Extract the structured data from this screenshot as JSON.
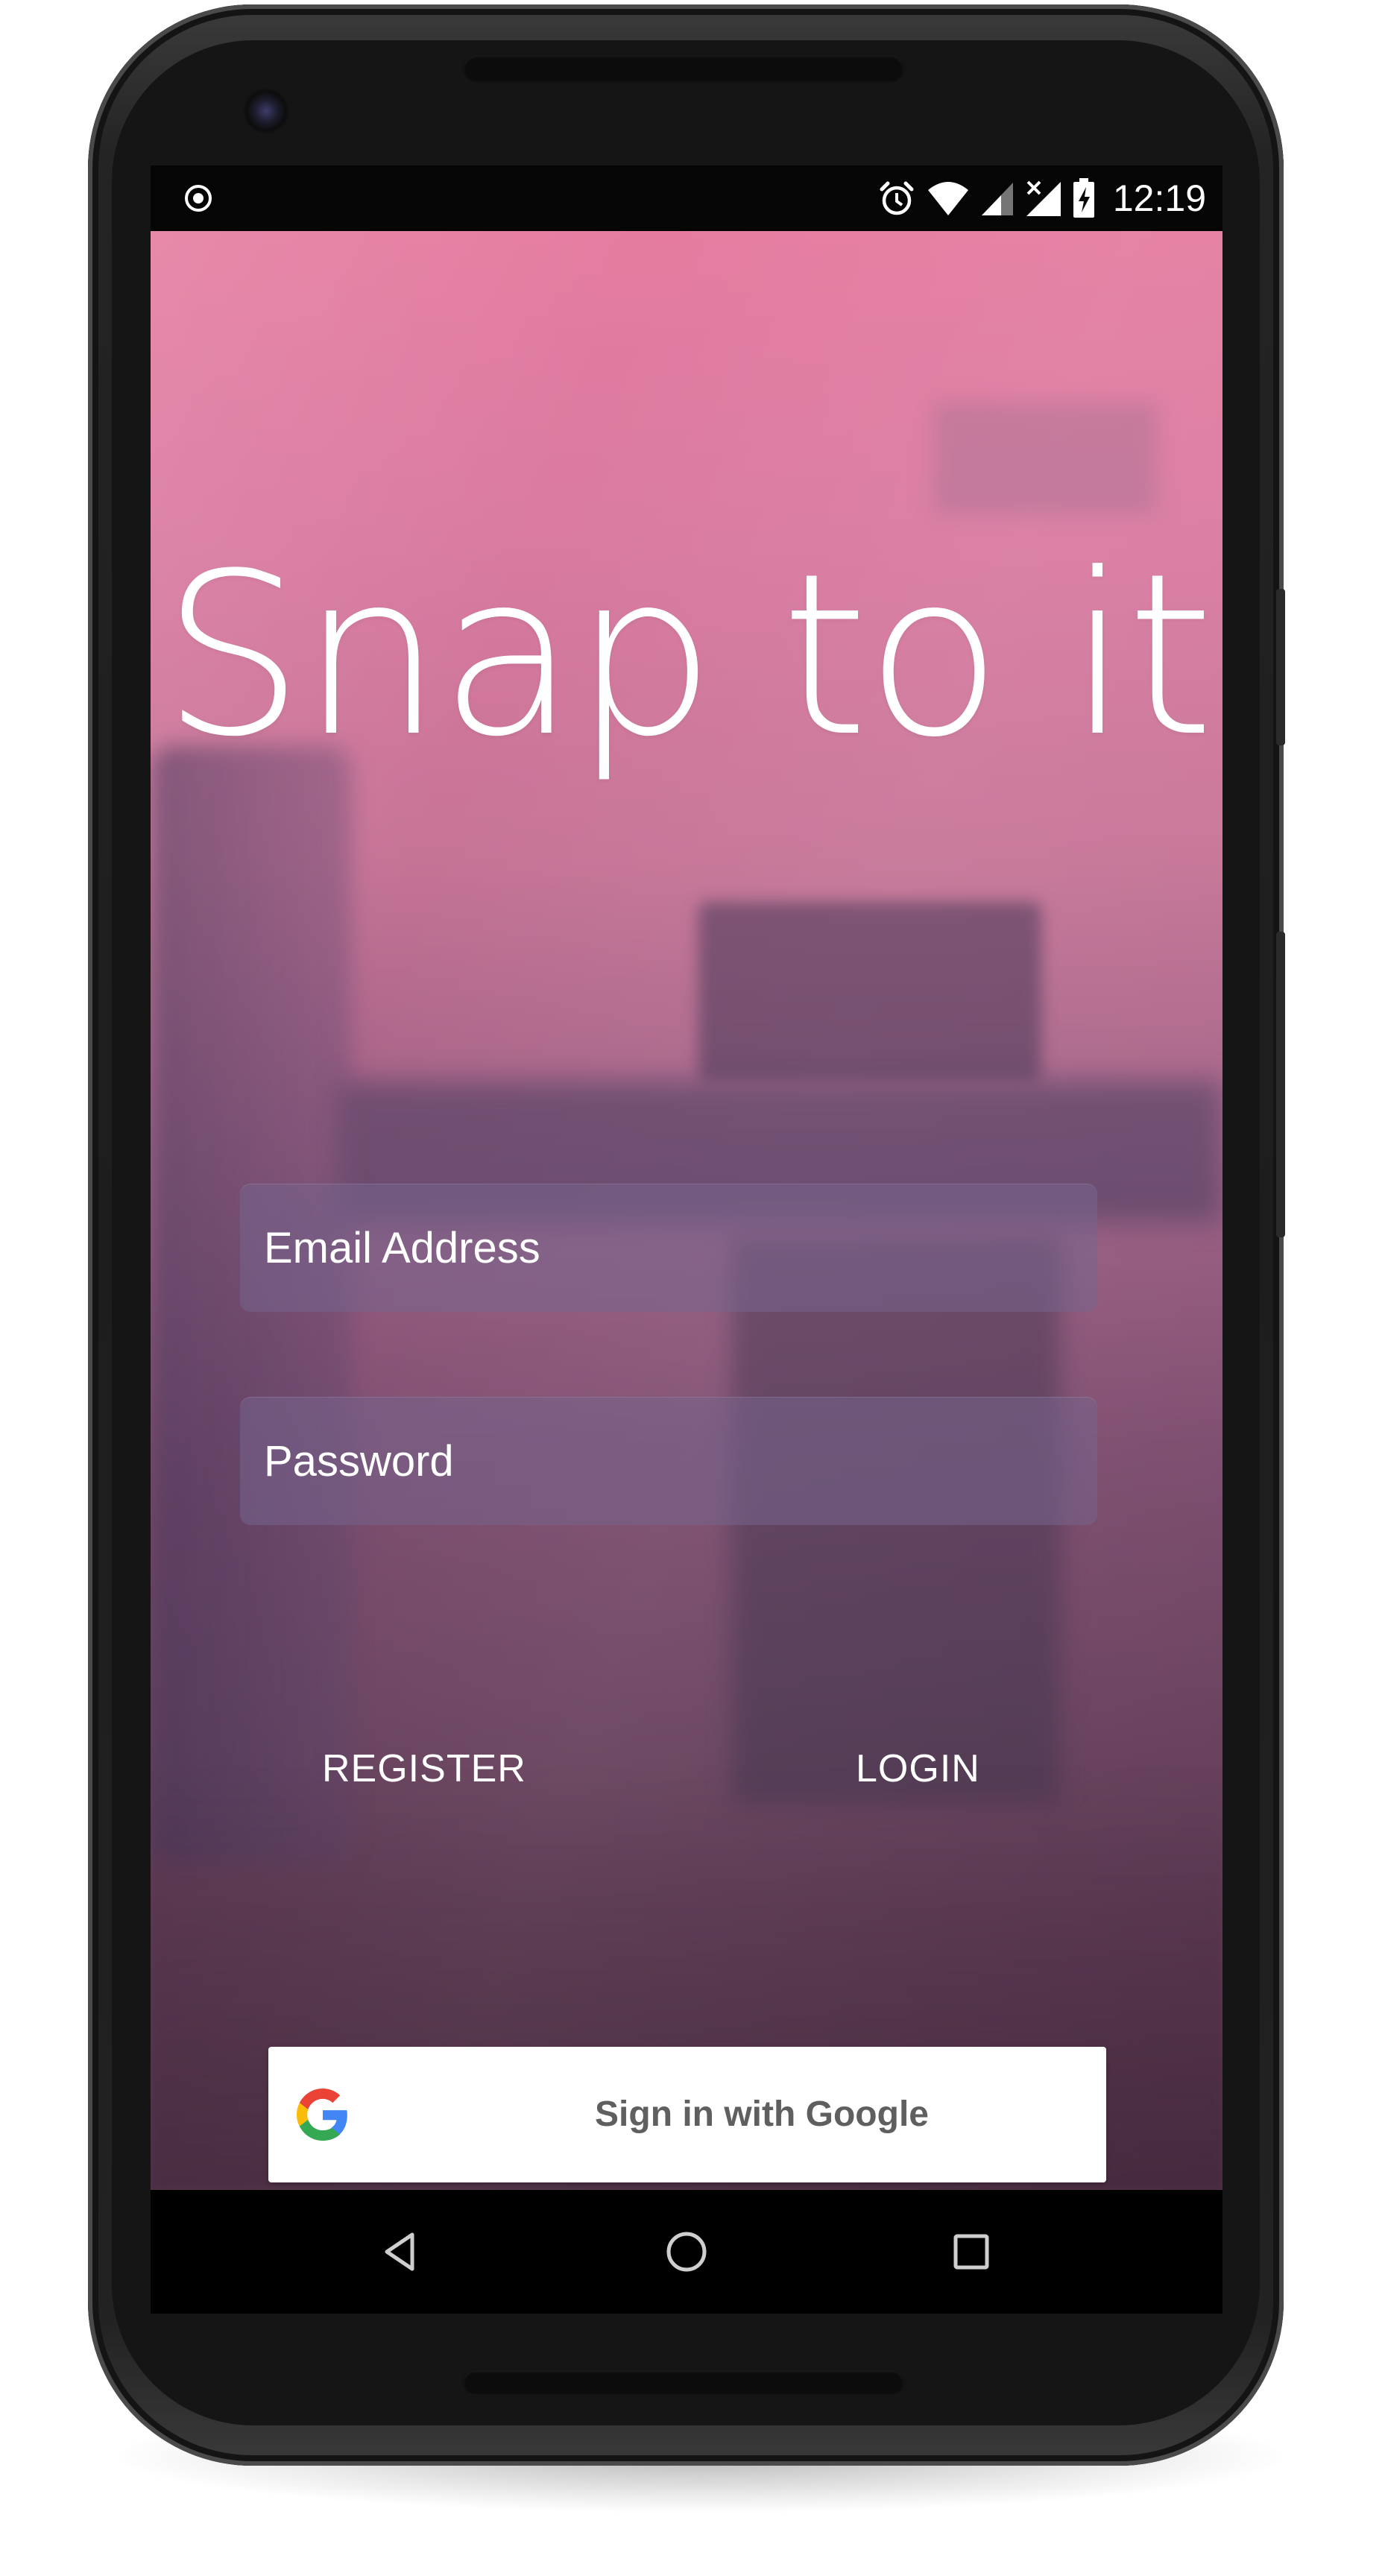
{
  "status_bar": {
    "left_icon": "sync-target-icon",
    "icons": [
      "alarm-icon",
      "wifi-icon",
      "signal-icon",
      "no-signal-icon",
      "battery-charging-icon"
    ],
    "time": "12:19"
  },
  "app": {
    "title": "Snap to it",
    "email_placeholder": "Email Address",
    "password_placeholder": "Password",
    "register_label": "REGISTER",
    "login_label": "LOGIN",
    "google_label": "Sign in with Google"
  },
  "nav_bar": {
    "back_icon": "back-triangle-icon",
    "home_icon": "home-circle-icon",
    "recents_icon": "recents-square-icon"
  },
  "colors": {
    "overlay_top": "#e57ca0",
    "overlay_bottom": "#4f3046",
    "field_bg": "#76648c",
    "google_text": "#5f5f5f"
  }
}
